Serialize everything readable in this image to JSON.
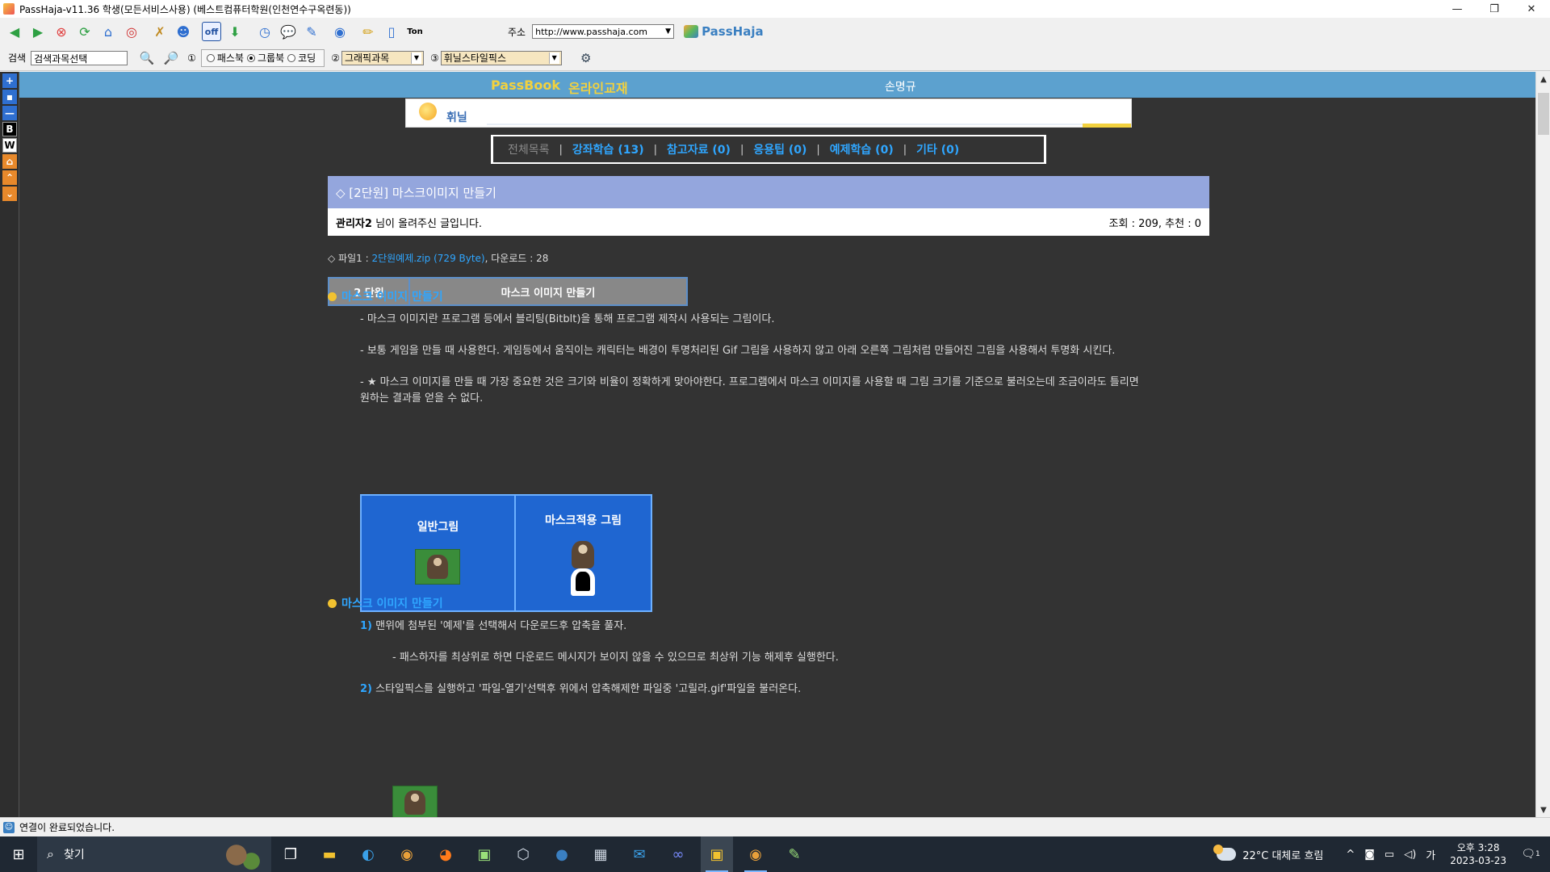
{
  "window": {
    "title": "PassHaja-v11.36  학생(모든서비스사용) (베스트컴퓨터학원(인천연수구옥련동))",
    "buttons": [
      "—",
      "❐",
      "✕"
    ]
  },
  "toolbar1": {
    "icons": [
      "back-arrow-icon",
      "forward-arrow-icon",
      "stop-icon",
      "refresh-icon",
      "home-icon",
      "target-icon",
      "key-icon",
      "users-icon",
      "off-icon",
      "download-icon",
      "clock-icon",
      "chat-icon",
      "edit-icon",
      "search-pen-icon",
      "pencil-icon",
      "notebook-icon",
      "ton-icon"
    ],
    "address_label": "주소",
    "address_value": "http://www.passhaja.com",
    "brand": "PassHaja"
  },
  "toolbar2": {
    "search_label": "검색",
    "search_value": "검색과목선택",
    "radio_num": "①",
    "radios": [
      {
        "label": "패스북",
        "checked": false
      },
      {
        "label": "그룹북",
        "checked": true
      },
      {
        "label": "코딩",
        "checked": false
      }
    ],
    "select2_num": "②",
    "select2_value": "그래픽과목",
    "select3_num": "③",
    "select3_value": "휘닐스타일픽스"
  },
  "rail": [
    "+",
    "▪",
    "—",
    "B",
    "W",
    "⌂",
    "⌃",
    "⌄"
  ],
  "header": {
    "logo": "PassBook",
    "subtitle": "온라인교재",
    "user": "손명규"
  },
  "banner": {
    "text": "휘닐"
  },
  "catnav": {
    "items": [
      "전체목록",
      "강좌학습 (13)",
      "참고자료 (0)",
      "응용팁 (0)",
      "예제학습 (0)",
      "기타 (0)"
    ]
  },
  "article": {
    "title": "◇ [2단원] 마스크이미지 만들기",
    "author": "관리자2",
    "author_suffix": " 님이 올려주신 글입니다.",
    "stats": "조회 : 209, 추천 : 0",
    "file_prefix": "◇ 파일1 : ",
    "file_link": "2단원예제.zip (729 Byte)",
    "file_suffix": ", 다운로드 : 28",
    "unit_label": "2 단원",
    "unit_title": "마스크 이미지 만들기"
  },
  "section1": {
    "heading": "마스크 이미지 만들기",
    "p1": "- 마스크 이미지란 프로그램 등에서 블리팅(Bitblt)을 통해 프로그램 제작시 사용되는 그림이다.",
    "p2": "- 보통 게임을 만들 때 사용한다. 게임등에서 움직이는 캐릭터는 배경이 투명처리된 Gif 그림을 사용하지 않고 아래 오른쪽 그림처럼 만들어진 그림을 사용해서 투명화 시킨다.",
    "p3a": "- ★ 마스크 이미지를 만들 때 가장 중요한 것은 크기와 비율이 정확하게 맞아야한다. 프로그램에서 마스크 이미지를 사용할 때 그림 크기를 기준으로 불러오는데 조금이라도 틀리면",
    "p3b": "원하는 결과를 얻을 수 없다.",
    "demo_left": "일반그림",
    "demo_right": "마스크적용 그림"
  },
  "section2": {
    "heading": "마스크 이미지 만들기",
    "step1_num": "1)",
    "step1": " 맨위에 첨부된 '예제'를 선택해서 다운로드후 압축을 풀자.",
    "step1_note": "- 패스하자를 최상위로 하면 다운로드 메시지가 보이지 않을 수 있으므로 최상위 기능 해제후 실행한다.",
    "step2_num": "2)",
    "step2": " 스타일픽스를 실행하고 '파일-열기'선택후 위에서 압축해제한 파일중 '고릴라.gif'파일을 불러온다."
  },
  "status": {
    "text": "연결이 완료되었습니다."
  },
  "taskbar": {
    "search_placeholder": "찾기",
    "weather": "22°C  대체로 흐림",
    "time": "오후 3:28",
    "date": "2023-03-23",
    "notif_count": "1"
  }
}
